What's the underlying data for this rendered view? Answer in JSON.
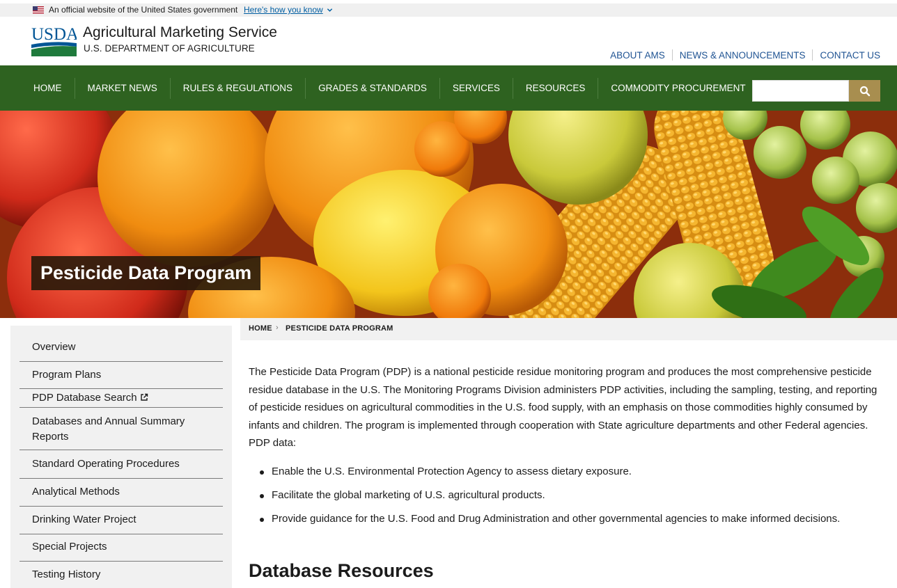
{
  "gov_banner": {
    "text": "An official website of the United States government",
    "link": "Here's how you know"
  },
  "header": {
    "logo_text": "USDA",
    "site_name": "Agricultural Marketing Service",
    "site_subtitle": "U.S. DEPARTMENT OF AGRICULTURE",
    "utility_links": [
      "ABOUT AMS",
      "NEWS & ANNOUNCEMENTS",
      "CONTACT US"
    ]
  },
  "nav": {
    "items": [
      "HOME",
      "MARKET NEWS",
      "RULES & REGULATIONS",
      "GRADES & STANDARDS",
      "SERVICES",
      "RESOURCES",
      "COMMODITY PROCUREMENT"
    ],
    "search_placeholder": ""
  },
  "hero": {
    "title": "Pesticide Data Program"
  },
  "sidebar": {
    "items": [
      "Overview",
      "Program Plans",
      "PDP Database Search",
      "Databases and Annual Summary Reports",
      "Standard Operating Procedures",
      "Analytical Methods",
      "Drinking Water Project",
      "Special Projects",
      "Testing History"
    ]
  },
  "breadcrumb": {
    "home": "HOME",
    "separator": "›",
    "current": "PESTICIDE DATA PROGRAM"
  },
  "main": {
    "intro": "The Pesticide Data Program (PDP) is a national pesticide residue monitoring program and produces the most comprehensive pesticide residue database in the U.S. The Monitoring Programs Division administers PDP activities, including the sampling, testing, and reporting of pesticide residues on agricultural commodities in the U.S. food supply, with an emphasis on those commodities highly consumed by infants and children. The program is implemented through cooperation with State agriculture departments and other Federal agencies. PDP data:",
    "bullets": [
      "Enable the U.S. Environmental Protection Agency to assess dietary exposure.",
      "Facilitate the global marketing of U.S. agricultural products.",
      "Provide guidance for the U.S. Food and Drug Administration and other governmental agencies to make informed decisions."
    ],
    "section_heading": "Database Resources"
  },
  "colors": {
    "nav_green": "#2e6220",
    "search_gold": "#a88e4f",
    "link_blue": "#205493",
    "logo_blue": "#005595",
    "logo_green": "#1f7a3c"
  }
}
